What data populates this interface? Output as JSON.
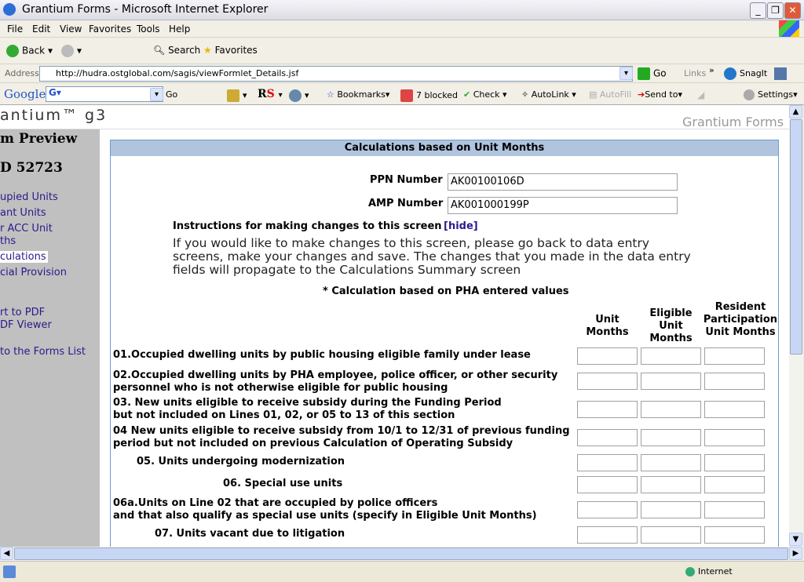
{
  "window": {
    "title": "Grantium Forms - Microsoft Internet Explorer"
  },
  "menu": [
    "File",
    "Edit",
    "View",
    "Favorites",
    "Tools",
    "Help"
  ],
  "toolbar": {
    "back": "Back",
    "search": "Search",
    "favorites": "Favorites"
  },
  "address": {
    "label": "Address",
    "url": "http://hudra.ostglobal.com/sagis/viewFormlet_Details.jsf",
    "go": "Go",
    "links": "Links",
    "snagit": "SnagIt"
  },
  "google": {
    "logo": "Google",
    "go": "Go",
    "bookmarks": "Bookmarks",
    "blocked": "7 blocked",
    "check": "Check",
    "autolink": "AutoLink",
    "autofill": "AutoFill",
    "sendto": "Send to",
    "settings": "Settings"
  },
  "header": {
    "logo": "antium™ g3",
    "brand": "Grantium Forms"
  },
  "sidebar": {
    "title": "m Preview",
    "id": "D 52723",
    "items": [
      "upied Units",
      "ant Units",
      "r ACC Unit",
      "ths",
      "culations",
      "cial Provision",
      "rt to PDF",
      "DF Viewer",
      "to the Forms List"
    ]
  },
  "panel": {
    "title": "Calculations based on Unit Months",
    "ppn_label": "PPN Number",
    "ppn_value": "AK00100106D",
    "amp_label": "AMP Number",
    "amp_value": "AK001000199P",
    "instr_label": "Instructions for making changes to this screen",
    "instr_hide": "[hide]",
    "instr_text": "If you would like to make changes to this screen, please go back to data entry screens, make your changes and save. The changes that you made in the data entry fields will propagate to the Calculations Summary screen",
    "calc_note": "* Calculation based on PHA entered values",
    "columns": [
      "Unit Months",
      "Eligible Unit Months",
      "Resident Participation Unit Months"
    ],
    "rows": [
      [
        "01.Occupied dwelling units by public housing eligible family under lease"
      ],
      [
        "02.Occupied dwelling units by PHA employee, police officer, or other security",
        "personnel who is not otherwise eligible for public housing"
      ],
      [
        "03. New units eligible to receive subsidy during the Funding Period",
        "but not included on Lines 01, 02, or 05 to 13 of this section"
      ],
      [
        "04 New units eligible to receive subsidy from 10/1 to 12/31 of previous funding",
        "period but not included on previous Calculation of Operating Subsidy"
      ],
      [
        "05. Units undergoing modernization"
      ],
      [
        "06. Special use units"
      ],
      [
        "06a.Units on Line 02 that are occupied by police officers",
        "and that also qualify as special use units (specify in Eligible Unit Months)"
      ],
      [
        "07. Units vacant due to litigation"
      ]
    ]
  },
  "status": {
    "zone": "Internet"
  }
}
